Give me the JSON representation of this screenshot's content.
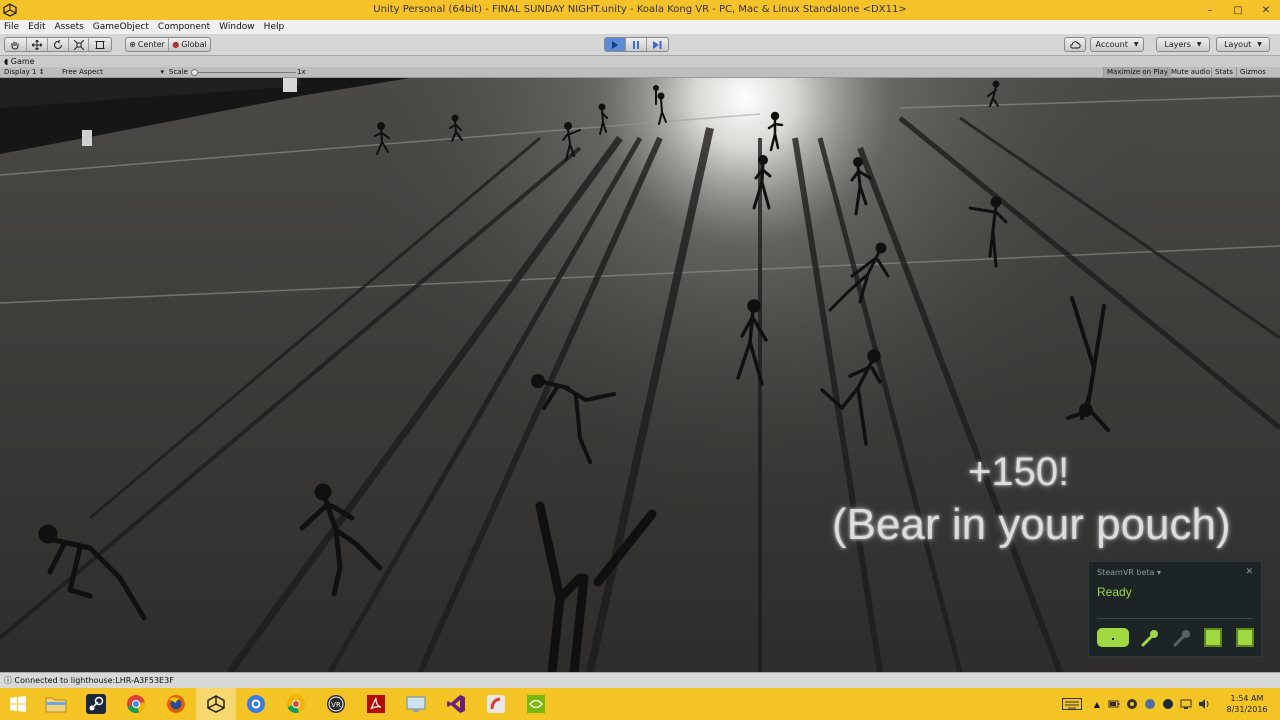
{
  "window": {
    "title": "Unity Personal (64bit) - FINAL SUNDAY NIGHT.unity - Koala Kong VR - PC, Mac & Linux Standalone <DX11>",
    "minimize": "–",
    "maximize": "□",
    "close": "✕"
  },
  "menu": [
    "File",
    "Edit",
    "Assets",
    "GameObject",
    "Component",
    "Window",
    "Help"
  ],
  "toolbar": {
    "pivot_label": "Center",
    "space_label": "Global",
    "account_label": "Account",
    "layers_label": "Layers",
    "layout_label": "Layout",
    "play_state": "playing"
  },
  "game_view": {
    "tab_label": "Game",
    "display": "Display 1",
    "aspect": "Free Aspect",
    "scale_label": "Scale",
    "scale_value": "1x",
    "maximize_on_play": "Maximize on Play",
    "mute_audio": "Mute audio",
    "stats": "Stats",
    "gizmos": "Gizmos"
  },
  "hud": {
    "score_text": "+150!",
    "bonus_text": "(Bear in your pouch)"
  },
  "steamvr": {
    "header": "SteamVR beta ▾",
    "close": "✕",
    "status": "Ready",
    "accent_color": "#9fd843"
  },
  "status_bar": {
    "message": "Connected to lighthouse:LHR-A3F53E3F"
  },
  "taskbar": {
    "apps": [
      "file-explorer",
      "steam",
      "chrome",
      "firefox",
      "unity",
      "chrome-remote",
      "chrome-canary",
      "vr-app",
      "acrobat",
      "network-app",
      "visual-studio",
      "git-app",
      "nvidia"
    ],
    "time": "1:54 AM",
    "date": "8/31/2016"
  }
}
